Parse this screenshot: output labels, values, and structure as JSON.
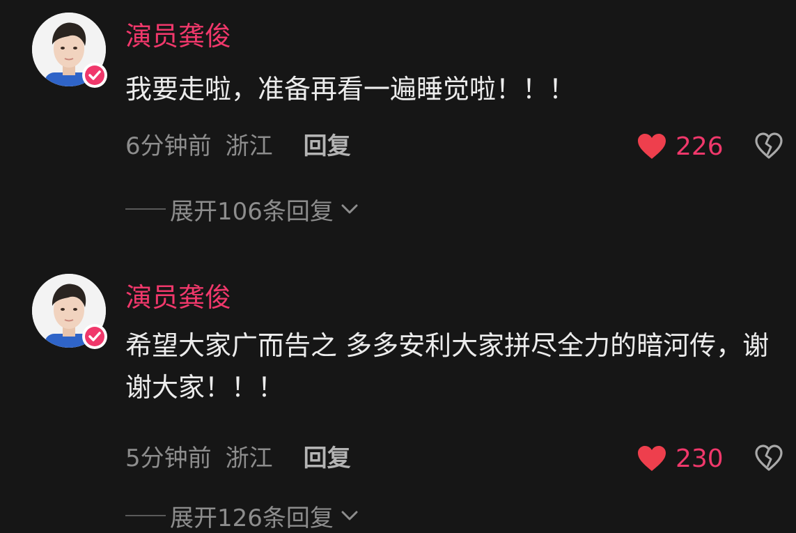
{
  "comments": [
    {
      "username": "演员龚俊",
      "text": "我要走啦，准备再看一遍睡觉啦！！！",
      "time": "6分钟前",
      "location": "浙江",
      "reply_label": "回复",
      "likes": "226",
      "expand_label": "展开106条回复"
    },
    {
      "username": "演员龚俊",
      "text": "希望大家广而告之  多多安利大家拼尽全力的暗河传，谢谢大家！！！",
      "time": "5分钟前",
      "location": "浙江",
      "reply_label": "回复",
      "likes": "230",
      "expand_label": "展开126条回复"
    }
  ],
  "icons": {
    "like": "heart-filled-icon",
    "dislike": "broken-heart-outline-icon",
    "verified": "verified-check-badge-icon",
    "expand": "chevron-down-icon"
  },
  "colors": {
    "background": "#161616",
    "accent": "#f0386b",
    "text": "#ececec",
    "muted": "#8d8d8d"
  }
}
